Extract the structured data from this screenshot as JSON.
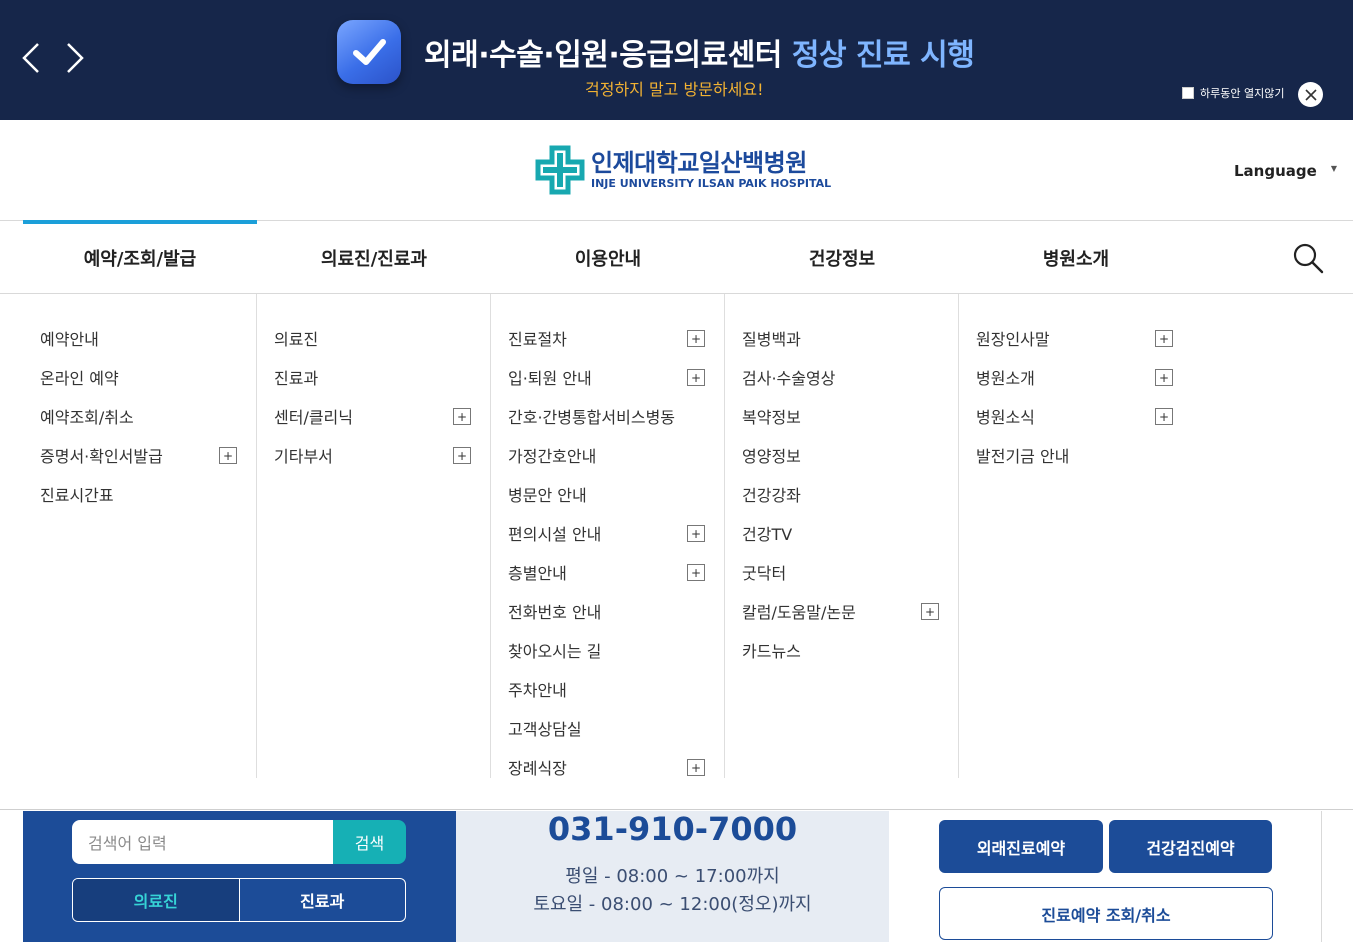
{
  "banner": {
    "headline_main": "외래·수술·입원·응급의료센터 ",
    "headline_accent": "정상 진료 시행",
    "subheadline": "걱정하지 말고 방문하세요!",
    "dismiss_label": "하루동안 열지않기",
    "check_icon": "check-icon",
    "colors": {
      "background": "#16264a",
      "accent": "#7fb5ff",
      "sub": "#f2b233"
    }
  },
  "header": {
    "logo_ko": "인제대학교일산백병원",
    "logo_en": "INJE UNIVERSITY ILSAN PAIK HOSPITAL",
    "language_label": "Language"
  },
  "gnb": {
    "items": [
      {
        "label": "예약/조회/발급",
        "active": true
      },
      {
        "label": "의료진/진료과"
      },
      {
        "label": "이용안내"
      },
      {
        "label": "건강정보"
      },
      {
        "label": "병원소개"
      }
    ],
    "active_color": "#1b9fd9"
  },
  "mega": {
    "columns": [
      {
        "items": [
          {
            "label": "예약안내",
            "expand": false
          },
          {
            "label": "온라인 예약",
            "expand": false
          },
          {
            "label": "예약조회/취소",
            "expand": false
          },
          {
            "label": "증명서·확인서발급",
            "expand": true
          },
          {
            "label": "진료시간표",
            "expand": false
          }
        ]
      },
      {
        "items": [
          {
            "label": "의료진",
            "expand": false
          },
          {
            "label": "진료과",
            "expand": false
          },
          {
            "label": "센터/클리닉",
            "expand": true
          },
          {
            "label": "기타부서",
            "expand": true
          }
        ]
      },
      {
        "items": [
          {
            "label": "진료절차",
            "expand": true
          },
          {
            "label": "입·퇴원 안내",
            "expand": true
          },
          {
            "label": "간호·간병통합서비스병동",
            "expand": false
          },
          {
            "label": "가정간호안내",
            "expand": false
          },
          {
            "label": "병문안 안내",
            "expand": false
          },
          {
            "label": "편의시설 안내",
            "expand": true
          },
          {
            "label": "층별안내",
            "expand": true
          },
          {
            "label": "전화번호 안내",
            "expand": false
          },
          {
            "label": "찾아오시는 길",
            "expand": false
          },
          {
            "label": "주차안내",
            "expand": false
          },
          {
            "label": "고객상담실",
            "expand": false
          },
          {
            "label": "장례식장",
            "expand": true
          }
        ]
      },
      {
        "items": [
          {
            "label": "질병백과",
            "expand": false
          },
          {
            "label": "검사·수술영상",
            "expand": false
          },
          {
            "label": "복약정보",
            "expand": false
          },
          {
            "label": "영양정보",
            "expand": false
          },
          {
            "label": "건강강좌",
            "expand": false
          },
          {
            "label": "건강TV",
            "expand": false
          },
          {
            "label": "굿닥터",
            "expand": false
          },
          {
            "label": "칼럼/도움말/논문",
            "expand": true
          },
          {
            "label": "카드뉴스",
            "expand": false
          }
        ]
      },
      {
        "items": [
          {
            "label": "원장인사말",
            "expand": true
          },
          {
            "label": "병원소개",
            "expand": true
          },
          {
            "label": "병원소식",
            "expand": true
          },
          {
            "label": "발전기금 안내",
            "expand": false
          }
        ]
      }
    ],
    "plus_symbol": "+"
  },
  "quick": {
    "search_placeholder": "검색어 입력",
    "search_button": "검색",
    "toggle_doctors": "의료진",
    "toggle_departments": "진료과",
    "phone": "031-910-7000",
    "hours_weekday": "평일 - 08:00 ~ 17:00까지",
    "hours_saturday": "토요일 - 08:00 ~ 12:00(정오)까지",
    "btn_outpatient": "외래진료예약",
    "btn_checkup": "건강검진예약",
    "btn_lookup": "진료예약 조회/취소"
  }
}
